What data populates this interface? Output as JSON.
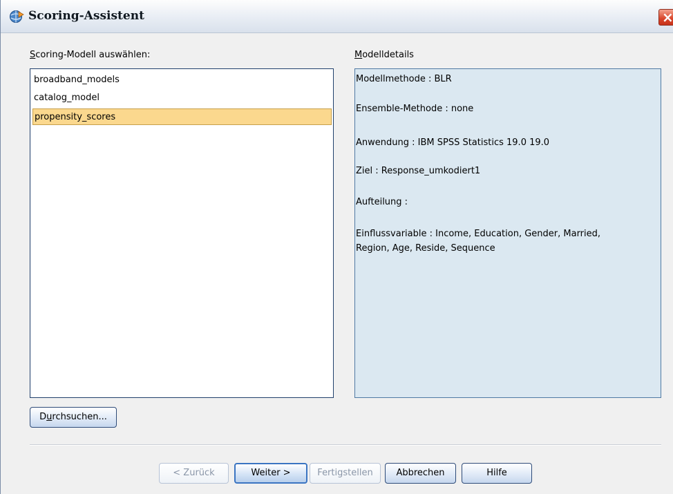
{
  "window": {
    "title": "Scoring-Assistent",
    "close_glyph": "×"
  },
  "model_select": {
    "label_prefix": "S",
    "label_rest": "coring-Modell auswählen:",
    "items": [
      {
        "label": "broadband_models",
        "selected": false
      },
      {
        "label": "catalog_model",
        "selected": false
      },
      {
        "label": "propensity_scores",
        "selected": true
      }
    ]
  },
  "details": {
    "label_prefix": "M",
    "label_rest": "odelldetails",
    "lines": [
      "Modellmethode : BLR",
      "Ensemble-Methode : none",
      "Anwendung : IBM SPSS Statistics 19.0 19.0",
      "Ziel : Response_umkodiert1",
      "Aufteilung :",
      "Einflussvariable : Income, Education, Gender, Married,",
      "Region, Age, Reside, Sequence"
    ]
  },
  "browse_button": {
    "prefix": "D",
    "accel": "u",
    "rest": "rchsuchen..."
  },
  "footer": {
    "back": "< Zurück",
    "next": "Weiter >",
    "finish": "Fertigstellen",
    "cancel": "Abbrechen",
    "help": "Hilfe"
  },
  "colors": {
    "selection": "#fbd88e",
    "details_bg": "#dbe8f1",
    "close_red": "#d9452a"
  },
  "icons": {
    "app": "scoring-wizard-icon",
    "close": "close-icon"
  }
}
